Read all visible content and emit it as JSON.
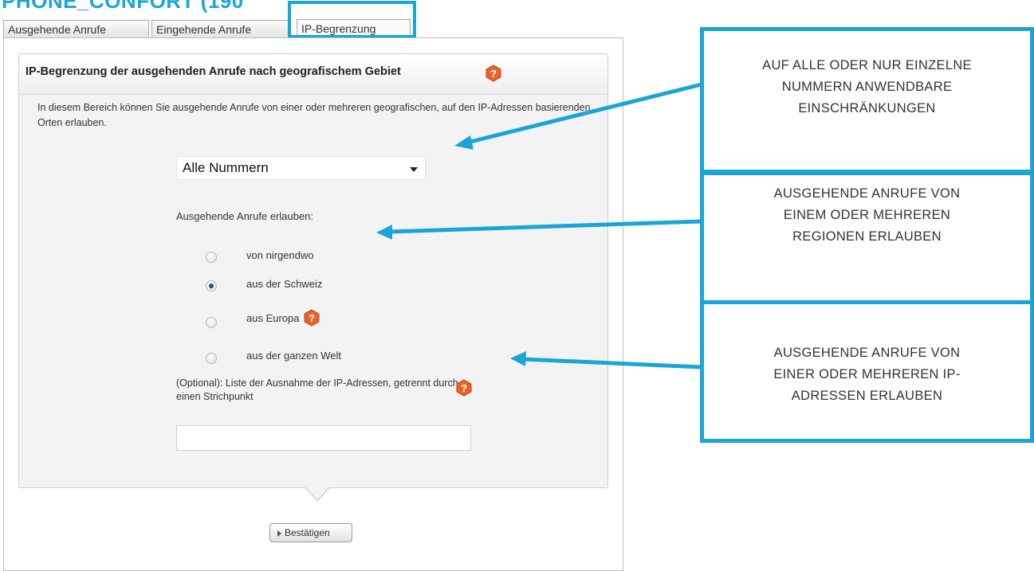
{
  "page_title": "PHONE_CONFORT (190",
  "tabs": [
    {
      "label": "Ausgehende Anrufe"
    },
    {
      "label": "Eingehende Anrufe"
    },
    {
      "label": "IP-Begrenzung"
    }
  ],
  "panel": {
    "title": "IP-Begrenzung der ausgehenden Anrufe nach geografischem Gebiet",
    "description": "In diesem Bereich können Sie ausgehende Anrufe von einer oder mehreren geografischen, auf den IP-Adressen basierenden Orten erlauben.",
    "number_select": {
      "value": "Alle Nummern"
    },
    "allow_label": "Ausgehende Anrufe erlauben:",
    "options": [
      {
        "label": "von nirgendwo",
        "checked": false
      },
      {
        "label": "aus der Schweiz",
        "checked": true
      },
      {
        "label": "aus Europa",
        "checked": false
      },
      {
        "label": "aus der ganzen Welt",
        "checked": false
      }
    ],
    "optional_label": "(Optional): Liste der Ausnahme der IP-Adressen, getrennt durch einen Strichpunkt",
    "ip_input_value": "",
    "confirm_label": "Bestätigen"
  },
  "annotations": [
    {
      "lines": [
        "AUF ALLE ODER NUR EINZELNE",
        "NUMMERN ANWENDBARE",
        "EINSCHRÄNKUNGEN"
      ]
    },
    {
      "lines": [
        "AUSGEHENDE ANRUFE VON",
        "EINEM ODER MEHREREN",
        "REGIONEN ERLAUBEN"
      ]
    },
    {
      "lines": [
        "AUSGEHENDE ANRUFE VON",
        "EINER ODER MEHREREN IP-",
        "ADRESSEN  ERLAUBEN"
      ]
    }
  ],
  "colors": {
    "accent": "#1aa5d8",
    "help_icon": "#e8632a"
  },
  "icons": {
    "help": "question-mark-hexagon-icon",
    "dropdown": "chevron-down-icon",
    "confirm": "triangle-right-icon"
  }
}
